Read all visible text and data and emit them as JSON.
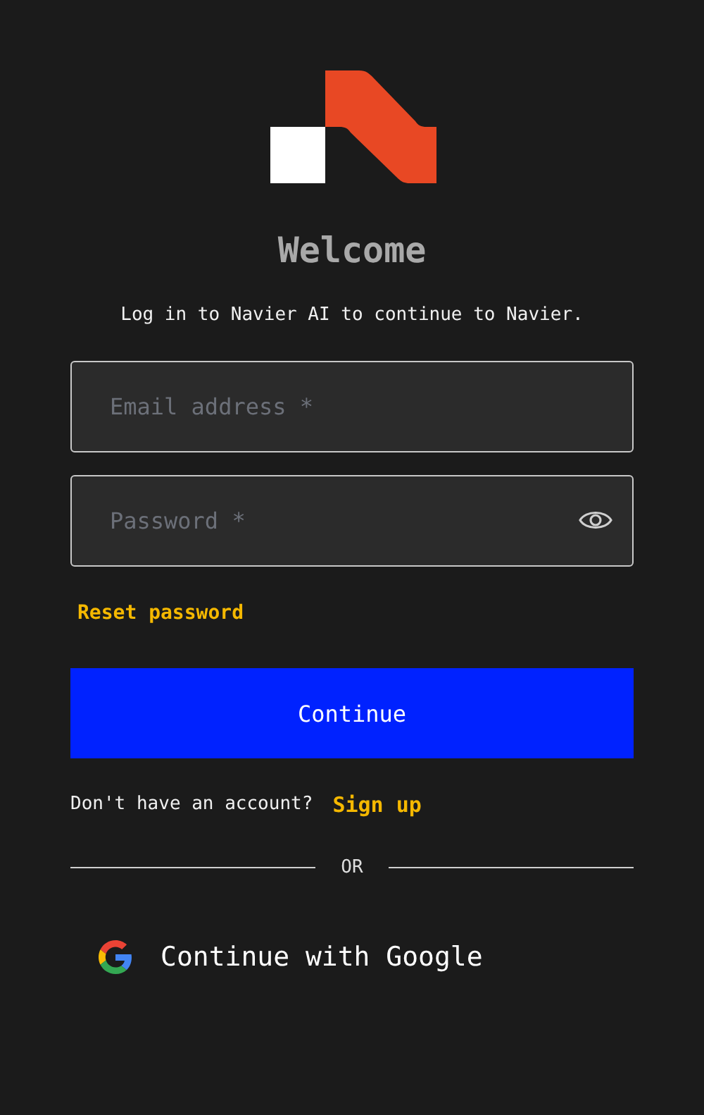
{
  "heading": "Welcome",
  "subtitle": "Log in to Navier AI to continue to Navier.",
  "fields": [
    {
      "kind": "email",
      "placeholder": "Email address *"
    },
    {
      "kind": "password",
      "placeholder": "Password *"
    }
  ],
  "reset_link": "Reset password",
  "submit_button": "Continue",
  "signup_prompt": "Don't have an account?",
  "signup_link": "Sign up",
  "divider_text": "OR",
  "social_button": "Continue with Google"
}
